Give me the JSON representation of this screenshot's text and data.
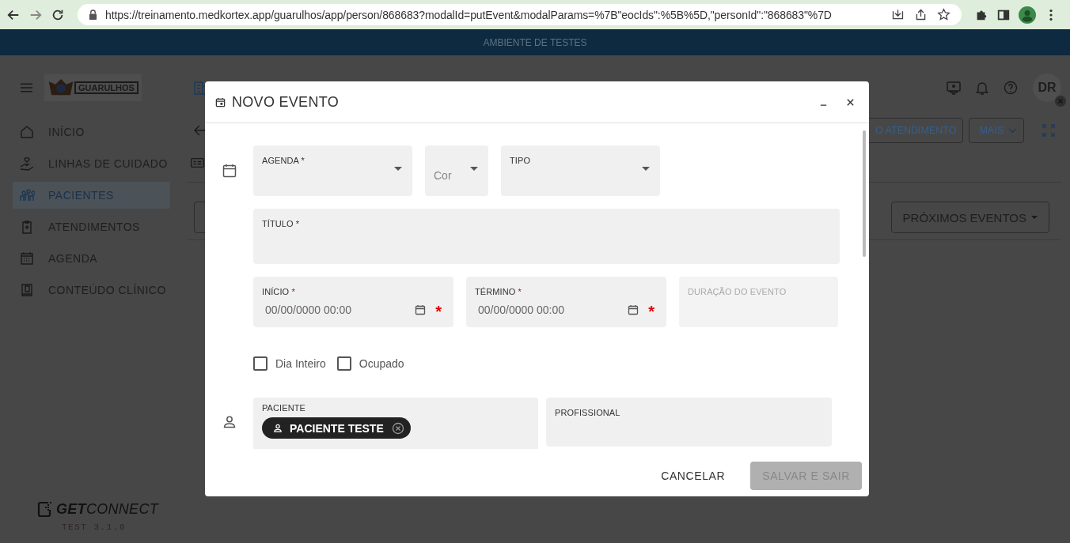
{
  "browser": {
    "url": "https://treinamento.medkortex.app/guarulhos/app/person/868683?modalId=putEvent&modalParams=%7B\"eocIds\":%5B%5D,\"personId\":\"868683\"%7D"
  },
  "banner": "AMBIENTE DE TESTES",
  "sidebar": {
    "logo_text": "GUARULHOS",
    "items": [
      {
        "label": "INÍCIO",
        "selected": false
      },
      {
        "label": "LINHAS DE CUIDADO",
        "selected": false
      },
      {
        "label": "PACIENTES",
        "selected": true
      },
      {
        "label": "ATENDIMENTOS",
        "selected": false
      },
      {
        "label": "AGENDA",
        "selected": false
      },
      {
        "label": "CONTEÚDO CLÍNICO",
        "selected": false
      }
    ],
    "brand": "**GET**CONNECT",
    "version": "TEST 3.1.0"
  },
  "header": {
    "avatar": "DR",
    "actions": [
      "O ATENDIMENTO",
      "MAIS"
    ],
    "events_button": "PRÓXIMOS EVENTOS"
  },
  "modal": {
    "title": "NOVO EVENTO",
    "agenda": {
      "label": "AGENDA *"
    },
    "color": {
      "placeholder": "Cor"
    },
    "type": {
      "label": "TIPO"
    },
    "event_title": {
      "label": "TÍTULO *"
    },
    "dates": [
      {
        "label": "INÍCIO",
        "required_mark": "*",
        "placeholder": "00/00/0000 00:00",
        "suffix": "*",
        "disabled": false
      },
      {
        "label": "TÉRMINO",
        "required_mark": "*",
        "placeholder": "00/00/0000 00:00",
        "suffix": "*",
        "disabled": false
      }
    ],
    "duration": {
      "label": "DURAÇÃO DO EVENTO",
      "disabled": true
    },
    "checkboxes": [
      {
        "label": "Dia Inteiro",
        "checked": false
      },
      {
        "label": "Ocupado",
        "checked": false
      }
    ],
    "patient": {
      "label": "PACIENTE",
      "chip": "PACIENTE TESTE"
    },
    "professional": {
      "label": "PROFISSIONAL"
    },
    "buttons": [
      {
        "label": "CANCELAR",
        "kind": "text",
        "disabled": false
      },
      {
        "label": "SALVAR E SAIR",
        "kind": "filled",
        "disabled": true
      }
    ]
  }
}
